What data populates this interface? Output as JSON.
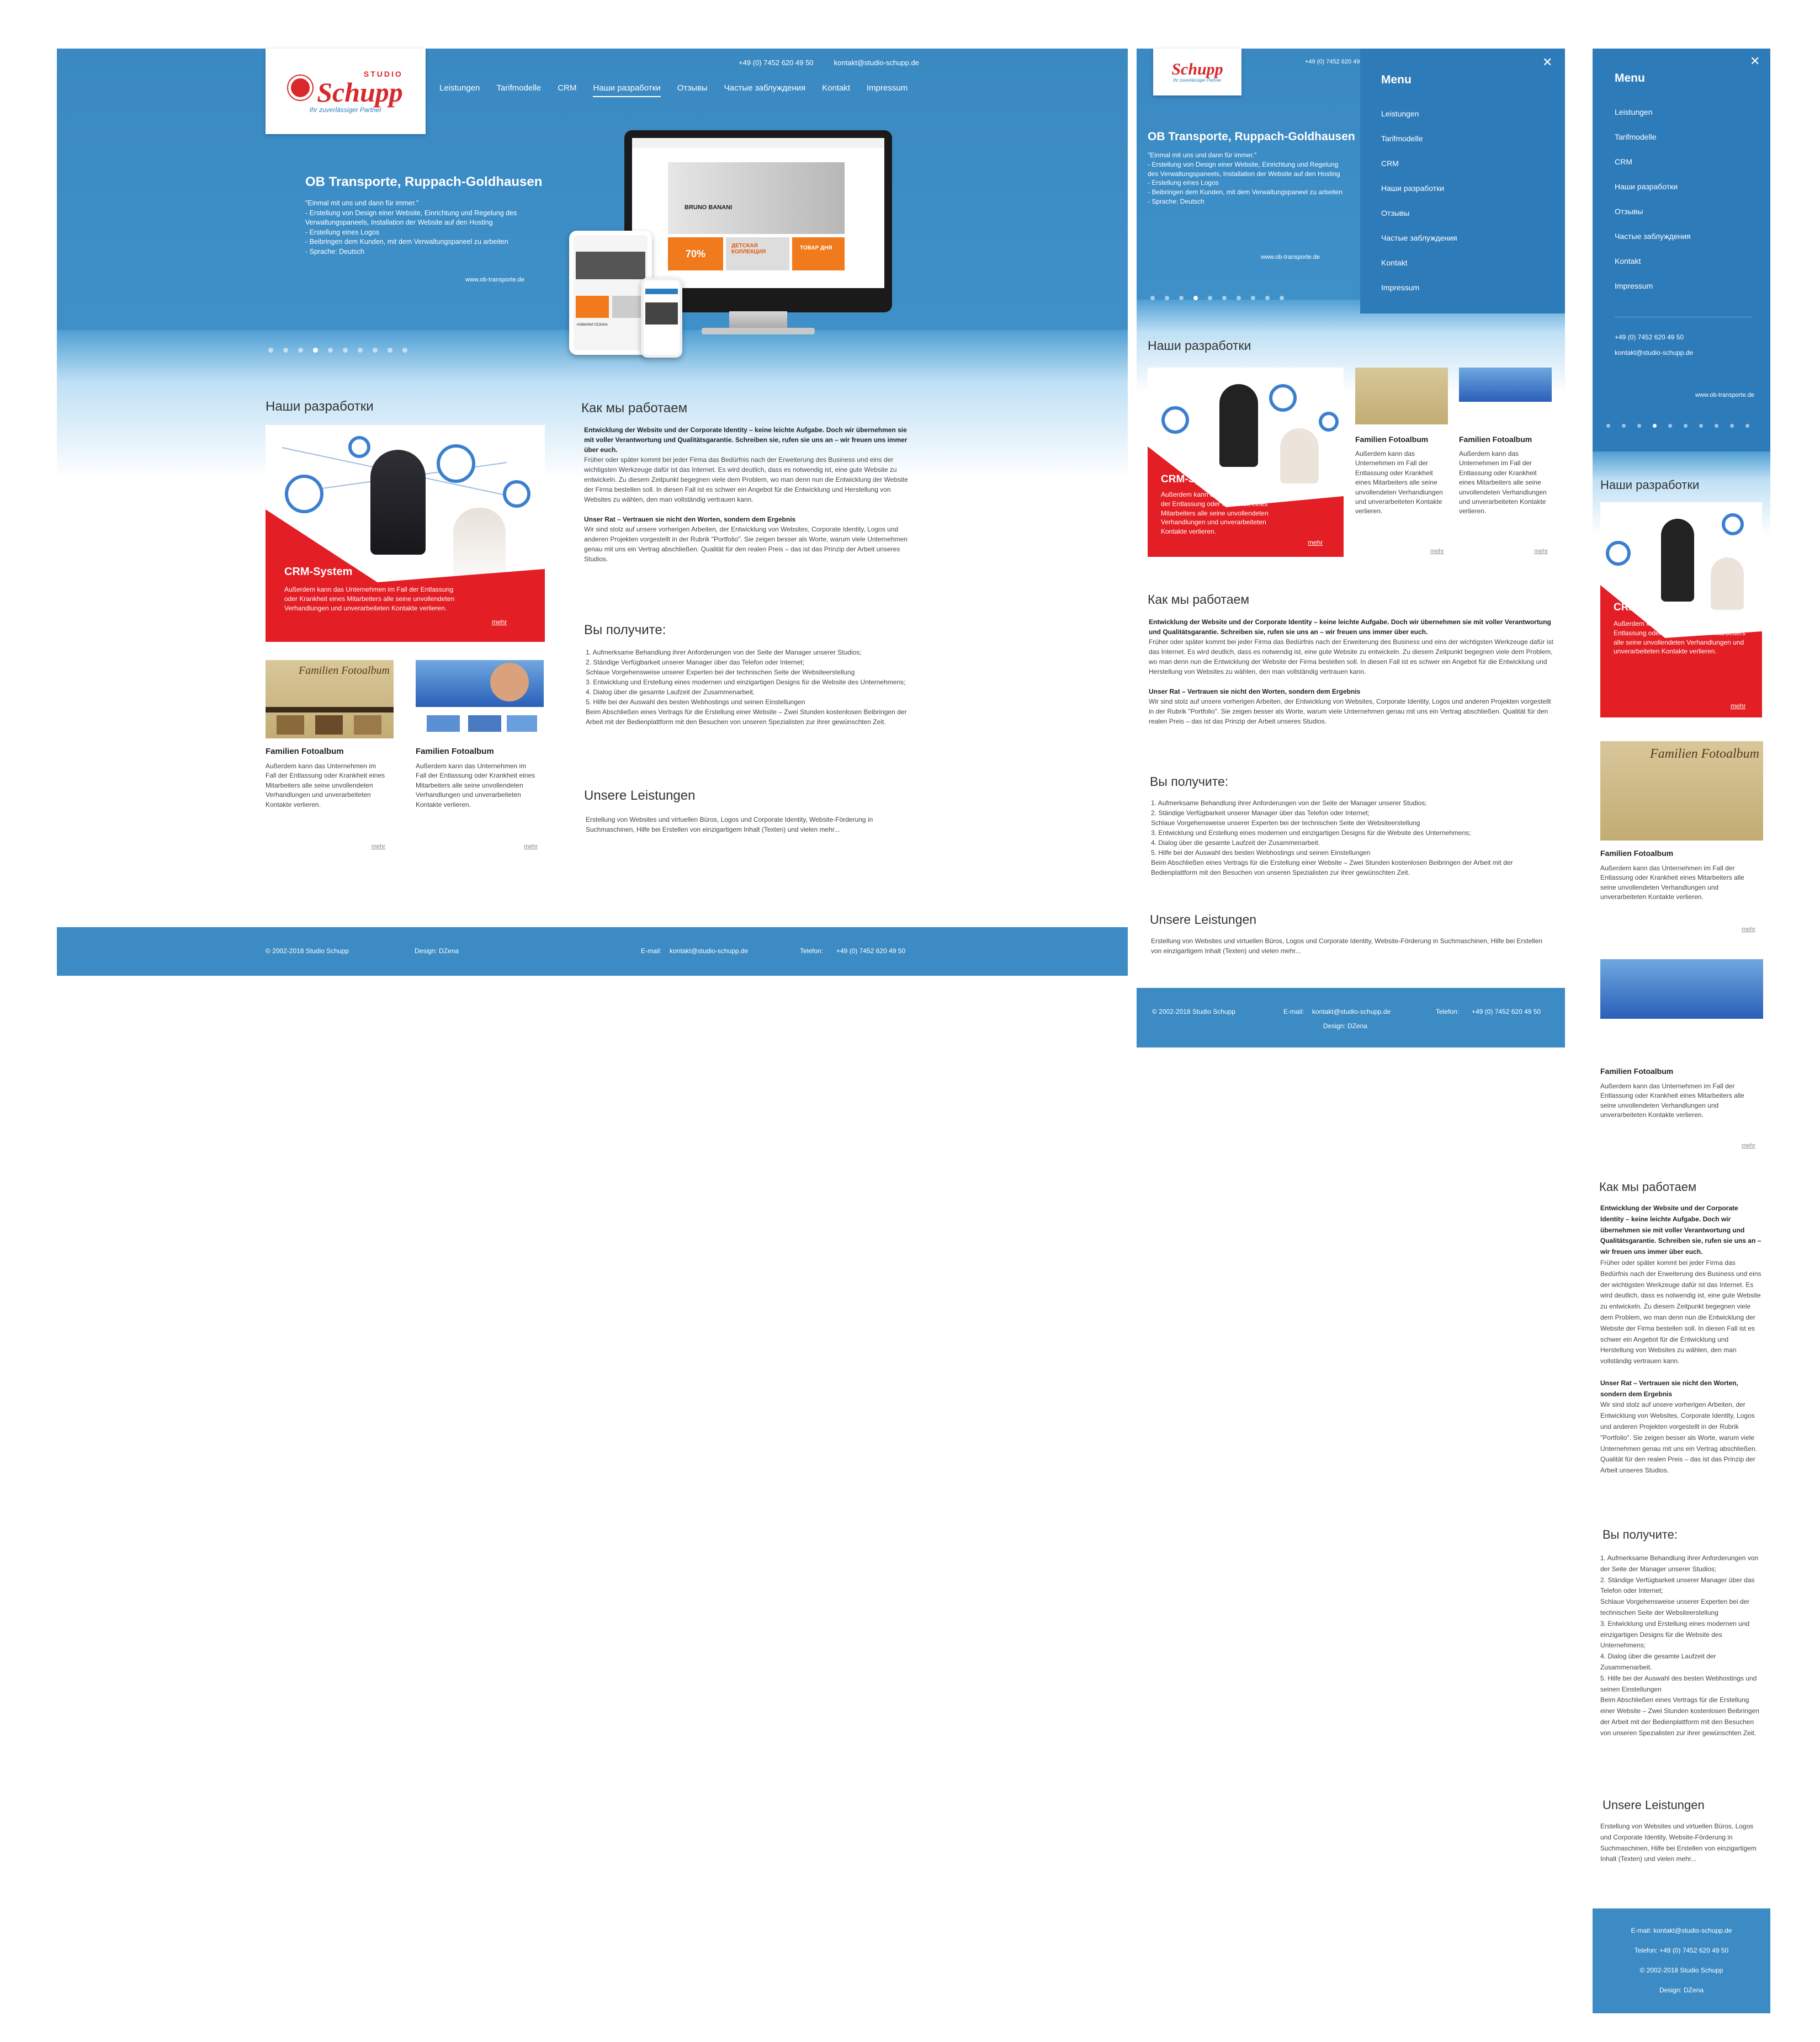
{
  "brand": {
    "studio": "STUDIO",
    "name": "Schupp",
    "tagline": "Ihr zuverlässiger Partner"
  },
  "contact": {
    "phone": "+49 (0) 7452 620 49 50",
    "email": "kontakt@studio-schupp.de"
  },
  "nav": [
    "Leistungen",
    "Tarifmodelle",
    "CRM",
    "Наши разработки",
    "Отзывы",
    "Частые заблуждения",
    "Kontakt",
    "Impressum"
  ],
  "menu": {
    "title": "Menu",
    "close": "✕"
  },
  "slide": {
    "title": "OB Transporte, Ruppach-Goldhausen",
    "lines": [
      "\"Einmal mit uns und dann für immer.\"",
      "- Erstellung von Design einer Website, Einrichtung und Regelung des Verwaltungspaneels, Installation der Website auf den Hosting",
      "- Erstellung eines Logos",
      "- Beibringen dem Kunden, mit dem Verwaltungspaneel zu arbeiten",
      "- Sprache: Deutsch"
    ],
    "link": "www.ob-transporte.de",
    "active_dot": 3,
    "dot_count": 10
  },
  "mockup": {
    "brand_name": "BRUNO BANANI",
    "sale": "70%",
    "collection": "ДЕТСКАЯ КОЛЛЕКЦИЯ",
    "tovar": "ТОВАР ДНЯ",
    "popular": "ПОПУЛЯРНЫЕ ТОВАРЫ",
    "new_arrivals": "НОВИНКИ СЕЗОНА"
  },
  "projects": {
    "heading": "Наши разработки",
    "crm": {
      "title": "CRM-System",
      "text": "Außerdem kann das Unternehmen im Fall der Entlassung oder Krankheit eines Mitarbeiters alle seine unvollendeten Verhandlungen und unverarbeiteten Kontakte verlieren.",
      "more": "mehr"
    },
    "cards": [
      {
        "title": "Familien Fotoalbum",
        "img_title": "Familien Fotoalbum",
        "text": "Außerdem kann das Unternehmen im Fall der Entlassung oder Krankheit eines Mitarbeiters alle seine unvollendeten Verhandlungen und unverarbeiteten Kontakte verlieren.",
        "more": "mehr"
      },
      {
        "title": "Familien Fotoalbum",
        "text": "Außerdem kann das Unternehmen im Fall der Entlassung oder Krankheit eines Mitarbeiters alle seine unvollendeten Verhandlungen und unverarbeiteten Kontakte verlieren.",
        "more": "mehr"
      }
    ]
  },
  "how": {
    "heading": "Как мы работаем",
    "p1_bold": "Entwicklung der Website und der Corporate Identity – keine leichte Aufgabe. Doch wir übernehmen sie mit voller Verantwortung und Qualitätsgarantie. Schreiben sie, rufen sie uns an – wir freuen uns immer über euch.",
    "p1": "Früher oder später kommt bei jeder Firma das Bedürfnis nach der Erweiterung des Business und eins der wichtigsten Werkzeuge dafür ist das Internet. Es wird deutlich, dass es notwendig ist, eine gute Website zu entwickeln. Zu diesem Zeitpunkt begegnen viele dem Problem, wo man denn nun die Entwicklung der Website der Firma bestellen soll. In diesen Fall ist es schwer ein Angebot für die Entwicklung und Herstellung von Websites zu wählen, den man vollständig vertrauen kann.",
    "p2_bold": "Unser Rat – Vertrauen sie nicht den Worten, sondern dem Ergebnis",
    "p2": "Wir sind stolz auf unsere vorherigen Arbeiten, der Entwicklung von Websites, Corporate Identity, Logos und anderen Projekten vorgestellt in der Rubrik \"Portfolio\". Sie zeigen besser als Worte, warum viele Unternehmen genau mit uns ein Vertrag abschließen. Qualität für den realen Preis – das ist das Prinzip der Arbeit unseres Studios."
  },
  "get": {
    "heading": "Вы получите:",
    "items": [
      "1. Aufmerksame Behandlung ihrer Anforderungen von der Seite der Manager unserer Studios;",
      "2. Ständige Verfügbarkeit unserer Manager über das Telefon oder Internet;",
      "Schlaue Vorgehensweise unserer Experten bei der technischen Seite der Websiteerstellung",
      "3. Entwicklung und Erstellung eines modernen und einzigartigen Designs für die Website des Unternehmens;",
      "4. Dialog über die gesamte Laufzeit der Zusammenarbeit.",
      "5. Hilfe bei der Auswahl des besten Webhostings und seinen Einstellungen",
      "Beim Abschließen eines Vertrags für die Erstellung einer Website – Zwei Stunden kostenlosen Beibringen der Arbeit mit der Bedienplattform mit den Besuchen von unseren Spezialisten zur ihrer gewünschten Zeit."
    ]
  },
  "services": {
    "heading": "Unsere Leistungen",
    "text": "Erstellung von Websites und virtuellen Büros, Logos und Corporate Identity, Website-Förderung in Suchmaschinen, Hilfe bei Erstellen von einzigartigem Inhalt (Texten) und vielen mehr..."
  },
  "footer": {
    "copy": "© 2002-2018  Studio Schupp",
    "design": "Design: DZena",
    "email_label": "E-mail:",
    "phone_label": "Telefon:"
  },
  "colors": {
    "blue": "#3c8bc4",
    "red": "#e31e24",
    "menu": "#2e7bb9"
  }
}
